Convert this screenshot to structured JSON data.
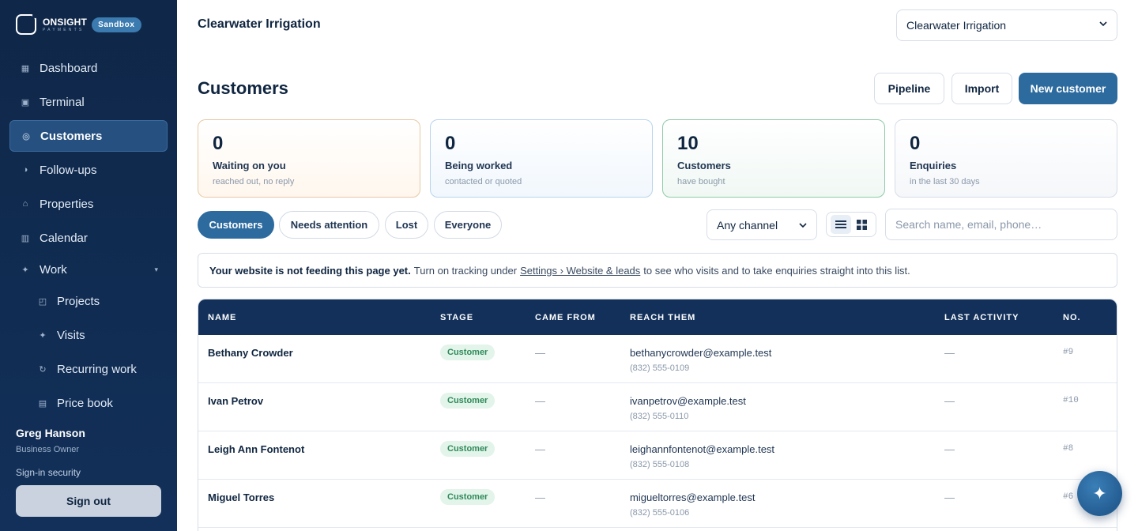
{
  "brand": {
    "name": "ONSIGHT",
    "sub": "PAYMENTS",
    "badge": "Sandbox"
  },
  "nav": {
    "dashboard": "Dashboard",
    "terminal": "Terminal",
    "customers": "Customers",
    "followups": "Follow-ups",
    "properties": "Properties",
    "calendar": "Calendar",
    "work": "Work",
    "projects": "Projects",
    "visits": "Visits",
    "recurring": "Recurring work",
    "pricebook": "Price book"
  },
  "user": {
    "name": "Greg Hanson",
    "role": "Business Owner",
    "security": "Sign-in security",
    "signout": "Sign out"
  },
  "header": {
    "org": "Clearwater Irrigation",
    "org_select": "Clearwater Irrigation"
  },
  "page": {
    "title": "Customers",
    "pipeline": "Pipeline",
    "import": "Import",
    "new_customer": "New customer"
  },
  "stats": [
    {
      "num": "0",
      "label": "Waiting on you",
      "sub": "reached out, no reply"
    },
    {
      "num": "0",
      "label": "Being worked",
      "sub": "contacted or quoted"
    },
    {
      "num": "10",
      "label": "Customers",
      "sub": "have bought"
    },
    {
      "num": "0",
      "label": "Enquiries",
      "sub": "in the last 30 days"
    }
  ],
  "filters": {
    "customers": "Customers",
    "attention": "Needs attention",
    "lost": "Lost",
    "everyone": "Everyone",
    "channel": "Any channel",
    "search_placeholder": "Search name, email, phone…"
  },
  "notice": {
    "bold": "Your website is not feeding this page yet.",
    "pre": "Turn on tracking under",
    "link": "Settings › Website & leads",
    "post": "to see who visits and to take enquiries straight into this list."
  },
  "table": {
    "headers": {
      "name": "NAME",
      "stage": "STAGE",
      "came": "CAME FROM",
      "reach": "REACH THEM",
      "last": "LAST ACTIVITY",
      "no": "NO."
    },
    "rows": [
      {
        "name": "Bethany Crowder",
        "stage": "Customer",
        "came": "—",
        "email": "bethanycrowder@example.test",
        "phone": "(832) 555-0109",
        "last": "—",
        "no": "#9"
      },
      {
        "name": "Ivan Petrov",
        "stage": "Customer",
        "came": "—",
        "email": "ivanpetrov@example.test",
        "phone": "(832) 555-0110",
        "last": "—",
        "no": "#10"
      },
      {
        "name": "Leigh Ann Fontenot",
        "stage": "Customer",
        "came": "—",
        "email": "leighannfontenot@example.test",
        "phone": "(832) 555-0108",
        "last": "—",
        "no": "#8"
      },
      {
        "name": "Miguel Torres",
        "stage": "Customer",
        "came": "—",
        "email": "migueltorres@example.test",
        "phone": "(832) 555-0106",
        "last": "—",
        "no": "#6"
      }
    ]
  },
  "colors": {
    "sidebar": "#0f2748",
    "accent": "#2d6b9f",
    "success": "#2f8a5a"
  }
}
